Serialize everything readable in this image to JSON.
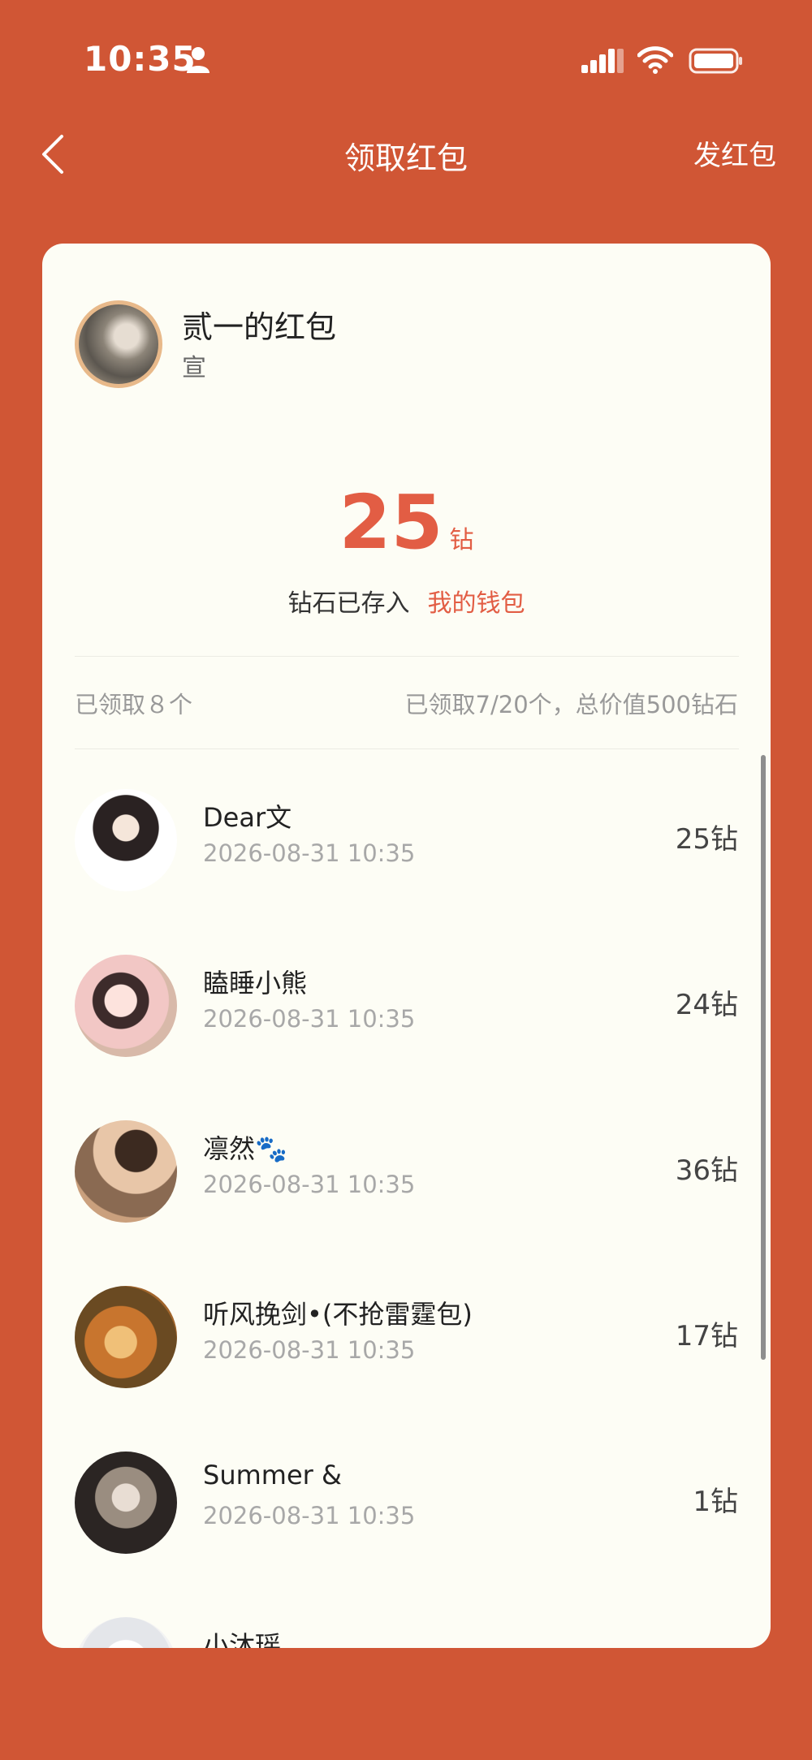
{
  "status_bar": {
    "time": "10:35"
  },
  "nav": {
    "title": "领取红包",
    "send_label": "发红包"
  },
  "sender": {
    "name": "贰一的红包",
    "subtitle": "宣"
  },
  "amount": {
    "value": "25",
    "unit": "钻"
  },
  "deposit": {
    "text": "钻石已存入",
    "wallet_link": "我的钱包"
  },
  "summary": {
    "left": "已领取８个",
    "right": "已领取7/20个，总价值500钻石"
  },
  "claims": [
    {
      "name": "Dear文",
      "time": "2026-08-31 10:35",
      "amount": "25钻"
    },
    {
      "name": "瞌睡小熊",
      "time": "2026-08-31 10:35",
      "amount": "24钻"
    },
    {
      "name": "凛然🐾",
      "time": "2026-08-31 10:35",
      "amount": "36钻"
    },
    {
      "name": "听风挽剑•(不抢雷霆包)",
      "time": "2026-08-31 10:35",
      "amount": "17钻"
    },
    {
      "name": "Summer &",
      "time": "2026-08-31 10:35",
      "amount": "1钻"
    },
    {
      "name": "小沐瑶.",
      "time": "",
      "amount": ""
    }
  ]
}
